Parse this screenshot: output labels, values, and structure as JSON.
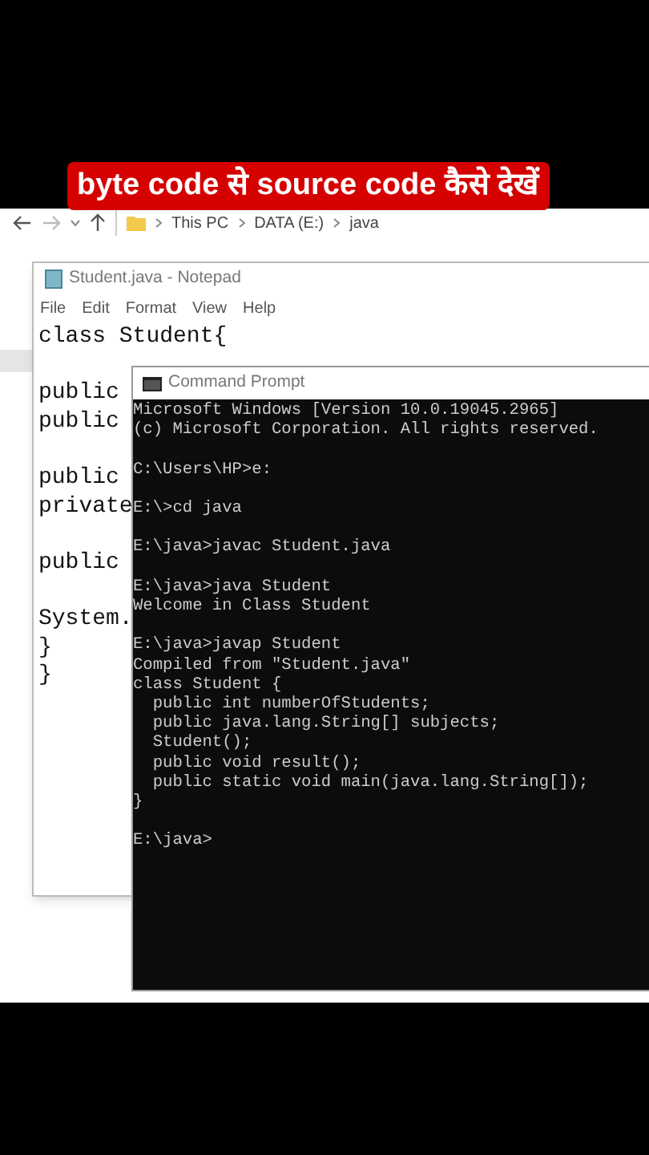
{
  "caption": "byte code से source code कैसे देखें",
  "explorer": {
    "breadcrumb": [
      "This PC",
      "DATA (E:)",
      "java"
    ]
  },
  "notepad": {
    "title": "Student.java - Notepad",
    "menu": [
      "File",
      "Edit",
      "Format",
      "View",
      "Help"
    ],
    "blocks": [
      [
        "class Student{"
      ],
      [
        "public",
        "public"
      ],
      [
        "public",
        "private"
      ],
      [
        "public"
      ],
      [
        "System.",
        "}",
        "}"
      ]
    ]
  },
  "cmd": {
    "title": "Command Prompt",
    "blocks": [
      [
        "Microsoft Windows [Version 10.0.19045.2965]",
        "(c) Microsoft Corporation. All rights reserved."
      ],
      [
        "C:\\Users\\HP>e:"
      ],
      [
        "E:\\>cd java"
      ],
      [
        "E:\\java>javac Student.java"
      ],
      [
        "E:\\java>java Student",
        "Welcome in Class Student"
      ],
      [
        "E:\\java>javap Student",
        "Compiled from \"Student.java\"",
        "class Student {",
        "  public int numberOfStudents;",
        "  public java.lang.String[] subjects;",
        "  Student();",
        "  public void result();",
        "  public static void main(java.lang.String[]);",
        "}"
      ],
      [
        "E:\\java>"
      ]
    ]
  }
}
